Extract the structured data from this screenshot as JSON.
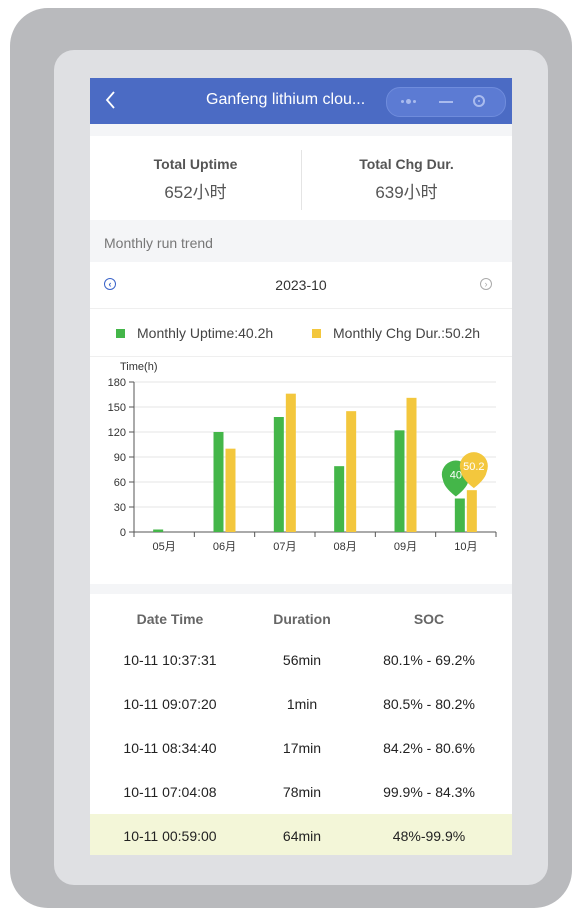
{
  "header": {
    "back_icon": "chevron-left-icon",
    "title": "Ganfeng lithium clou..."
  },
  "totals": {
    "uptime_label": "Total Uptime",
    "uptime_value": "652小时",
    "charge_label": "Total Chg Dur.",
    "charge_value": "639小时"
  },
  "trend": {
    "title": "Monthly run trend",
    "month": "2023-10"
  },
  "legend": {
    "uptime": "Monthly Uptime:40.2h",
    "charge": "Monthly Chg Dur.:50.2h"
  },
  "colors": {
    "uptime": "#44b649",
    "charge": "#f3c73d",
    "nav": "#4b6bc4",
    "highlight_row": "#f3f6d8"
  },
  "chart_data": {
    "type": "bar",
    "ylabel": "Time(h)",
    "ylim": [
      0,
      180
    ],
    "yticks": [
      0,
      30,
      60,
      90,
      120,
      150,
      180
    ],
    "categories": [
      "05月",
      "06月",
      "07月",
      "08月",
      "09月",
      "10月"
    ],
    "series": [
      {
        "name": "Monthly Uptime",
        "values": [
          3,
          120,
          138,
          79,
          122,
          40.2
        ]
      },
      {
        "name": "Monthly Chg Dur.",
        "values": [
          0,
          100,
          166,
          145,
          161,
          50.2
        ]
      }
    ],
    "bubbles": {
      "uptime_label": "40",
      "charge_label": "50.2"
    }
  },
  "table": {
    "headers": [
      "Date Time",
      "Duration",
      "SOC"
    ],
    "rows": [
      [
        "10-11 10:37:31",
        "56min",
        "80.1% - 69.2%"
      ],
      [
        "10-11 09:07:20",
        "1min",
        "80.5% - 80.2%"
      ],
      [
        "10-11 08:34:40",
        "17min",
        "84.2% - 80.6%"
      ],
      [
        "10-11 07:04:08",
        "78min",
        "99.9% - 84.3%"
      ],
      [
        "10-11 00:59:00",
        "64min",
        "48%-99.9%"
      ]
    ]
  }
}
